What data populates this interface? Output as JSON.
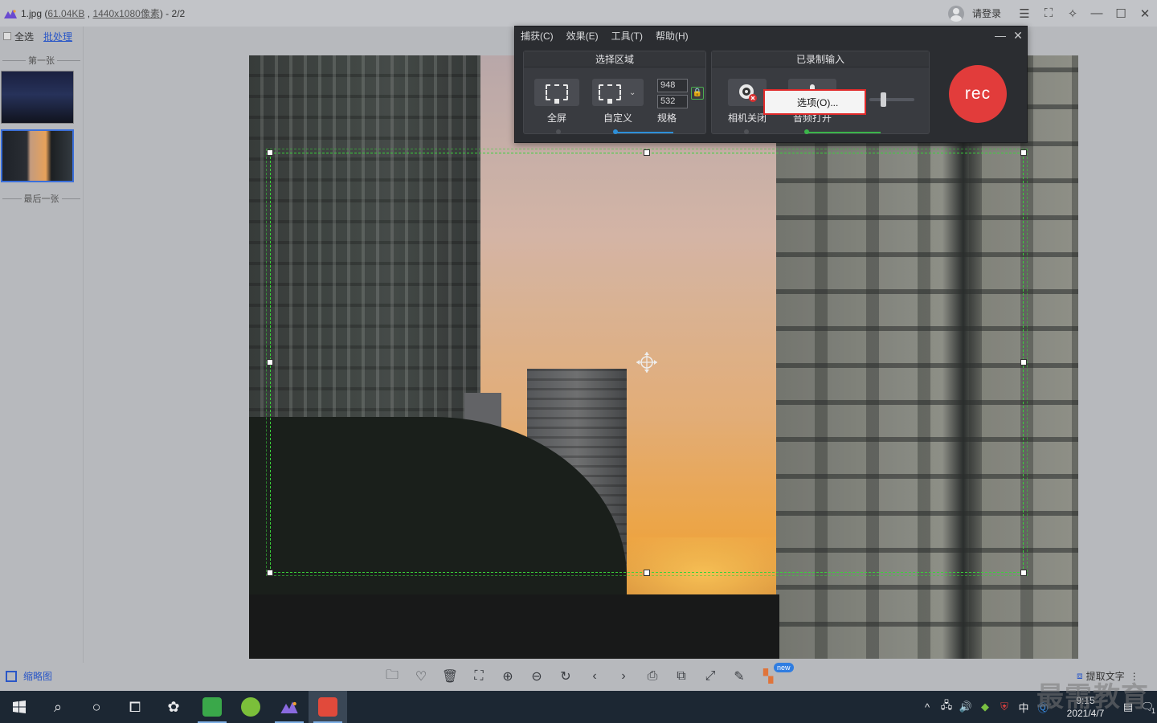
{
  "viewer": {
    "file_name": "1.jpg",
    "file_size": "61.04KB",
    "resolution": "1440x1080像素",
    "page_counter": "2/2",
    "login_label": "请登录"
  },
  "left_panel": {
    "select_all_label": "全选",
    "batch_label": "批处理",
    "first_label": "第一张",
    "last_label": "最后一张"
  },
  "recorder": {
    "menu": [
      "捕获(C)",
      "效果(E)",
      "工具(T)",
      "帮助(H)"
    ],
    "select_area_title": "选择区域",
    "recorded_input_title": "已录制输入",
    "fullscreen_label": "全屏",
    "custom_label": "自定义",
    "spec_label": "规格",
    "width_value": "948",
    "height_value": "532",
    "camera_label": "相机关闭",
    "audio_label": "音频打开",
    "rec_label": "rec",
    "options_menu_item": "选项(O)..."
  },
  "bottom": {
    "thumbnails_label": "缩略图",
    "new_badge": "new",
    "extract_text_label": "提取文字"
  },
  "taskbar": {
    "time": "9:15",
    "date": "2021/4/7",
    "ime": "中",
    "notification_count": "1"
  },
  "watermark": "最需教育",
  "colors": {
    "selection": "#39d33a",
    "rec_button": "#e23c3b",
    "highlight_box": "#e12a2a",
    "link": "#2a57c7"
  }
}
